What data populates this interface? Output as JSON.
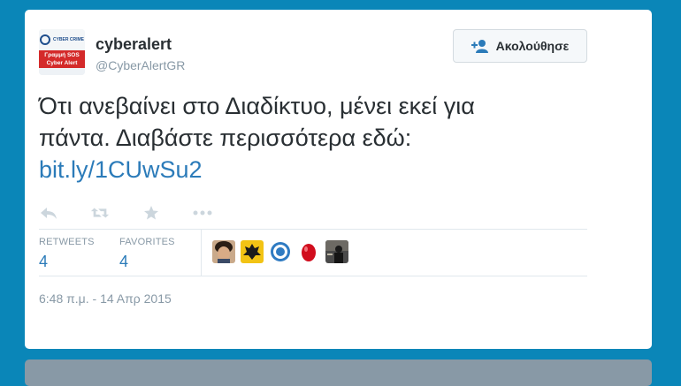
{
  "user": {
    "name": "cyberalert",
    "handle": "@CyberAlertGR",
    "avatar_text": [
      "Γραμμή SOS",
      "Cyber Alert"
    ],
    "avatar_logo_text": "CYBER CRIME"
  },
  "follow_button": {
    "label": "Ακολούθησε",
    "icon": "add-user-icon"
  },
  "tweet": {
    "line1": "Ότι ανεβαίνει στο Διαδίκτυο, μένει εκεί για",
    "line2": "πάντα. Διαβάστε περισσότερα εδώ:",
    "link": "bit.ly/1CUwSu2"
  },
  "actions": [
    "reply-icon",
    "retweet-icon",
    "favorite-icon",
    "more-icon"
  ],
  "stats": {
    "retweets_label": "RETWEETS",
    "retweets": "4",
    "favorites_label": "FAVORITES",
    "favorites": "4"
  },
  "favoriters": [
    "favoriter-avatar-1",
    "favoriter-avatar-2",
    "favoriter-avatar-3",
    "favoriter-avatar-4",
    "favoriter-avatar-5"
  ],
  "timestamp": "6:48 π.μ. - 14 Απρ 2015",
  "colors": {
    "background": "#0a86b8",
    "link": "#2b7bb9",
    "muted": "#8899a6",
    "text": "#292f33"
  }
}
